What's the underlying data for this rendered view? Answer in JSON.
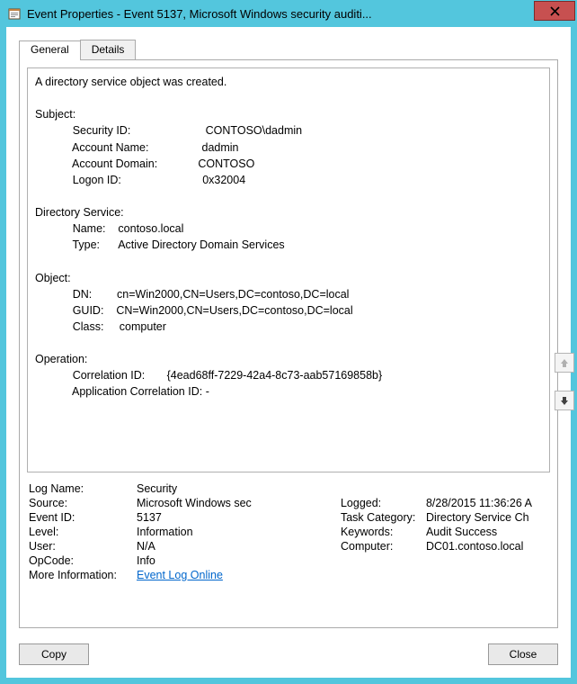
{
  "window": {
    "title": "Event Properties - Event 5137, Microsoft Windows security auditi..."
  },
  "tabs": {
    "general": "General",
    "details": "Details"
  },
  "desc": {
    "summary": "A directory service object was created.",
    "subject_hdr": "Subject:",
    "subject": {
      "sid_lbl": "Security ID:",
      "sid_val": "CONTOSO\\dadmin",
      "acct_lbl": "Account Name:",
      "acct_val": "dadmin",
      "dom_lbl": "Account Domain:",
      "dom_val": "CONTOSO",
      "logon_lbl": "Logon ID:",
      "logon_val": "0x32004"
    },
    "ds_hdr": "Directory Service:",
    "ds": {
      "name_lbl": "Name:",
      "name_val": "contoso.local",
      "type_lbl": "Type:",
      "type_val": "Active Directory Domain Services"
    },
    "obj_hdr": "Object:",
    "obj": {
      "dn_lbl": "DN:",
      "dn_val": "cn=Win2000,CN=Users,DC=contoso,DC=local",
      "guid_lbl": "GUID:",
      "guid_val": "CN=Win2000,CN=Users,DC=contoso,DC=local",
      "class_lbl": "Class:",
      "class_val": "computer"
    },
    "op_hdr": "Operation:",
    "op": {
      "corr_lbl": "Correlation ID:",
      "corr_val": "{4ead68ff-7229-42a4-8c73-aab57169858b}",
      "appcorr_lbl": "Application Correlation ID:",
      "appcorr_val": "-"
    }
  },
  "props": {
    "logname_lbl": "Log Name:",
    "logname_val": "Security",
    "source_lbl": "Source:",
    "source_val": "Microsoft Windows sec",
    "logged_lbl": "Logged:",
    "logged_val": "8/28/2015 11:36:26 A",
    "eventid_lbl": "Event ID:",
    "eventid_val": "5137",
    "taskcat_lbl": "Task Category:",
    "taskcat_val": "Directory Service Ch",
    "level_lbl": "Level:",
    "level_val": "Information",
    "keywords_lbl": "Keywords:",
    "keywords_val": "Audit Success",
    "user_lbl": "User:",
    "user_val": "N/A",
    "computer_lbl": "Computer:",
    "computer_val": "DC01.contoso.local",
    "opcode_lbl": "OpCode:",
    "opcode_val": "Info",
    "moreinfo_lbl": "More Information:",
    "moreinfo_link": "Event Log Online "
  },
  "buttons": {
    "copy": "Copy",
    "close": "Close"
  }
}
